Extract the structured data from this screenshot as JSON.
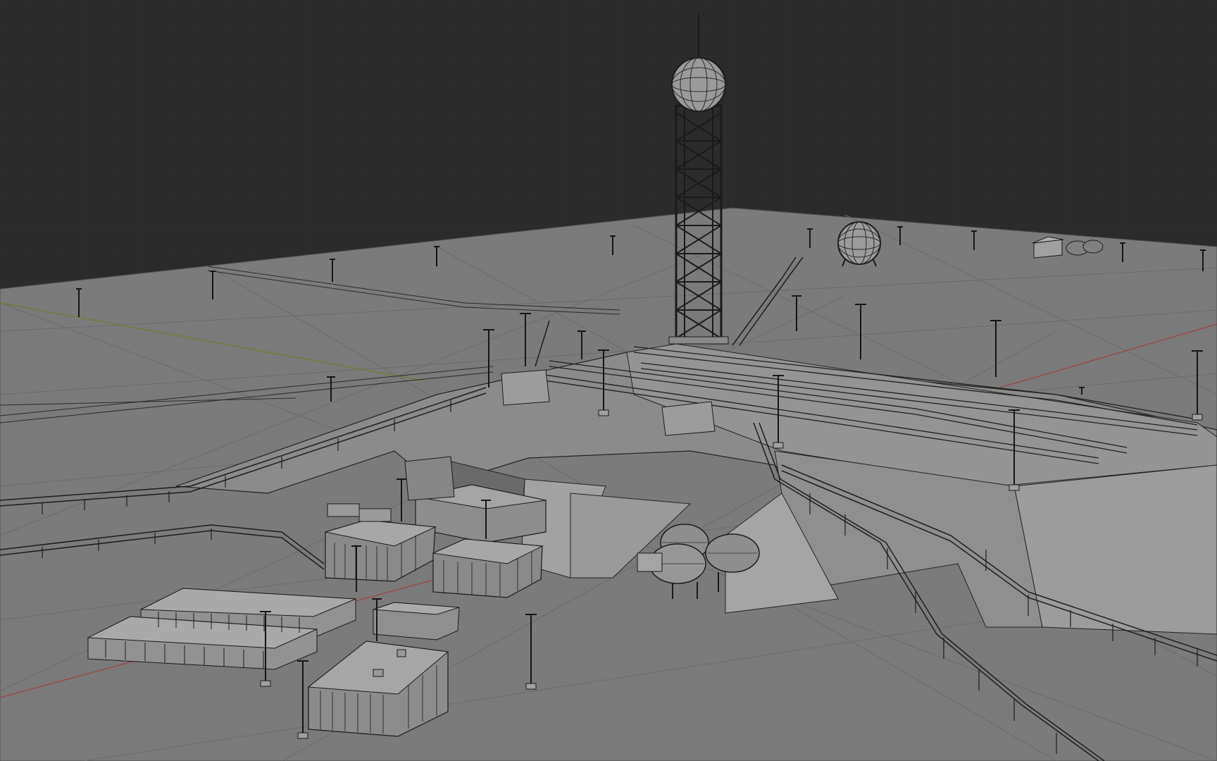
{
  "viewport": {
    "kind": "3d-viewport-wireframe-overlay",
    "shading": "solid-gray",
    "colors": {
      "background": "#2b2b2b",
      "background_grid": "#353535",
      "ground": "#7a7a7a",
      "ground_grid": "#6d6d6d",
      "model_face_light": "#9a9a9a",
      "model_face_mid": "#8a8a8a",
      "model_face_dark": "#767676",
      "wire": "#1a1a1a",
      "axis_x": "#a0403e",
      "axis_y": "#6f7d3a"
    }
  },
  "objects": [
    {
      "name": "tower-with-sphere-tank",
      "icon": "tower"
    },
    {
      "name": "spherical-tank",
      "icon": "sphere"
    },
    {
      "name": "launch-pad-platform",
      "icon": "platform"
    },
    {
      "name": "rail-tracks",
      "icon": "rails"
    },
    {
      "name": "flame-trench-ramps",
      "icon": "ramp"
    },
    {
      "name": "elevated-pipelines",
      "icon": "pipe"
    },
    {
      "name": "horizontal-tanks",
      "icon": "tank"
    },
    {
      "name": "service-buildings",
      "icon": "building"
    },
    {
      "name": "container-rows",
      "icon": "containers"
    },
    {
      "name": "street-lamps",
      "icon": "lamp"
    },
    {
      "name": "small-hut-and-tanks",
      "icon": "hut"
    }
  ]
}
